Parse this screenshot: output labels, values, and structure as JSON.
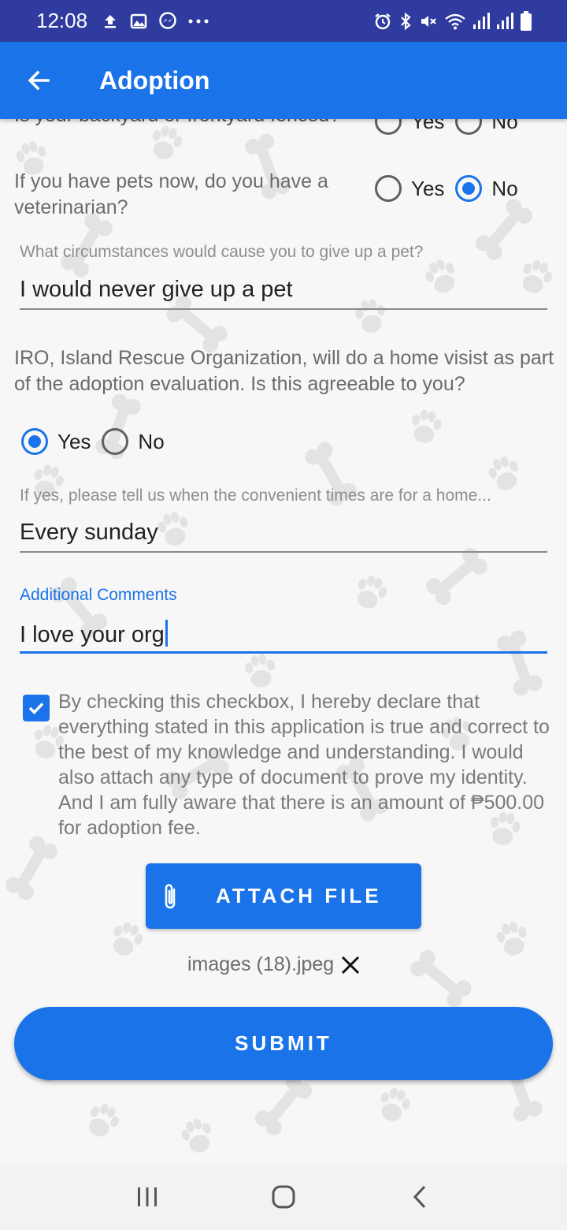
{
  "status_bar": {
    "time": "12:08",
    "left_icons": [
      "upload-icon",
      "image-icon",
      "messenger-icon",
      "more-icon"
    ],
    "right_icons": [
      "alarm-icon",
      "bluetooth-icon",
      "mute-icon",
      "wifi-icon",
      "signal-icon",
      "signal-icon",
      "battery-icon"
    ]
  },
  "app_bar": {
    "title": "Adoption"
  },
  "form": {
    "q_fenced": {
      "text": "Is your backyard or frontyard fenced?",
      "yes": "Yes",
      "no": "No"
    },
    "q_vet": {
      "text": "If you have pets now, do you have a veterinarian?",
      "yes": "Yes",
      "no": "No",
      "selected": "No"
    },
    "q_giveup": {
      "label": "What circumstances would cause you to give up a pet?",
      "value": "I would never give up a pet"
    },
    "q_homevisit": {
      "text": "IRO, Island Rescue Organization, will do a home visist as part of the adoption evaluation. Is this agreeable to you?",
      "yes": "Yes",
      "no": "No",
      "selected": "Yes"
    },
    "q_times": {
      "label": "If yes, please tell us when the convenient times are for a home...",
      "value": "Every sunday"
    },
    "q_comments": {
      "label": "Additional Comments",
      "value": "I love your org"
    },
    "declaration": {
      "checked": true,
      "text": "By checking this checkbox, I hereby declare that everything stated in this application is true and correct to the best of my knowledge and understanding. I would also attach any type of document to prove my identity. And I am fully aware that there is an amount of ₱500.00 for adoption fee."
    },
    "attach_button": "ATTACH FILE",
    "attached_file": "images (18).jpeg",
    "submit_button": "SUBMIT"
  },
  "colors": {
    "primary": "#1a73e8",
    "status_bar": "#2f3b9e",
    "background": "#f7f7f7"
  },
  "nav_bar": {
    "icons": [
      "recents-icon",
      "home-icon",
      "back-icon"
    ]
  }
}
